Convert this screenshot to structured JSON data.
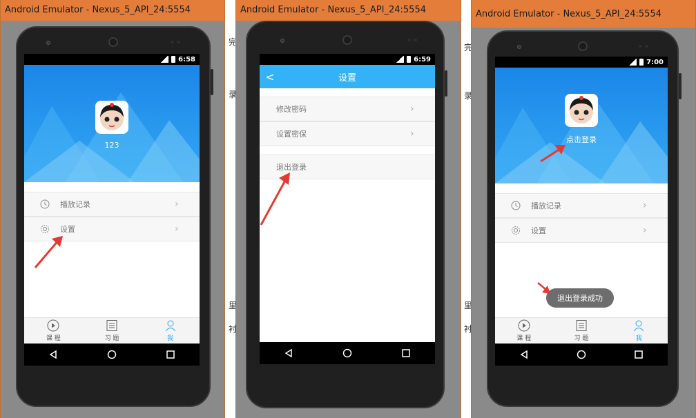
{
  "window_title": "Android Emulator - Nexus_5_API_24:5554",
  "screens": {
    "profile": {
      "time": "6:58",
      "username": "123"
    },
    "settings": {
      "time": "6:59",
      "back_glyph": "<",
      "title": "设置",
      "items": [
        {
          "label": "修改密码"
        },
        {
          "label": "设置密保"
        },
        {
          "label": "退出登录"
        }
      ]
    },
    "logged_out": {
      "time": "7:00",
      "login_prompt": "点击登录",
      "toast": "退出登录成功"
    }
  },
  "menu": {
    "history_label": "播放记录",
    "settings_label": "设置"
  },
  "tabs": [
    {
      "label": "课 程",
      "icon": "play-circle-icon"
    },
    {
      "label": "习 题",
      "icon": "list-icon"
    },
    {
      "label": "我",
      "icon": "person-icon"
    }
  ],
  "background_fragments": [
    "完",
    "录",
    "里",
    "衬"
  ],
  "colors": {
    "accent": "#33b2f8",
    "hero": "#1b86e8",
    "title_bar": "#e47d3a"
  }
}
